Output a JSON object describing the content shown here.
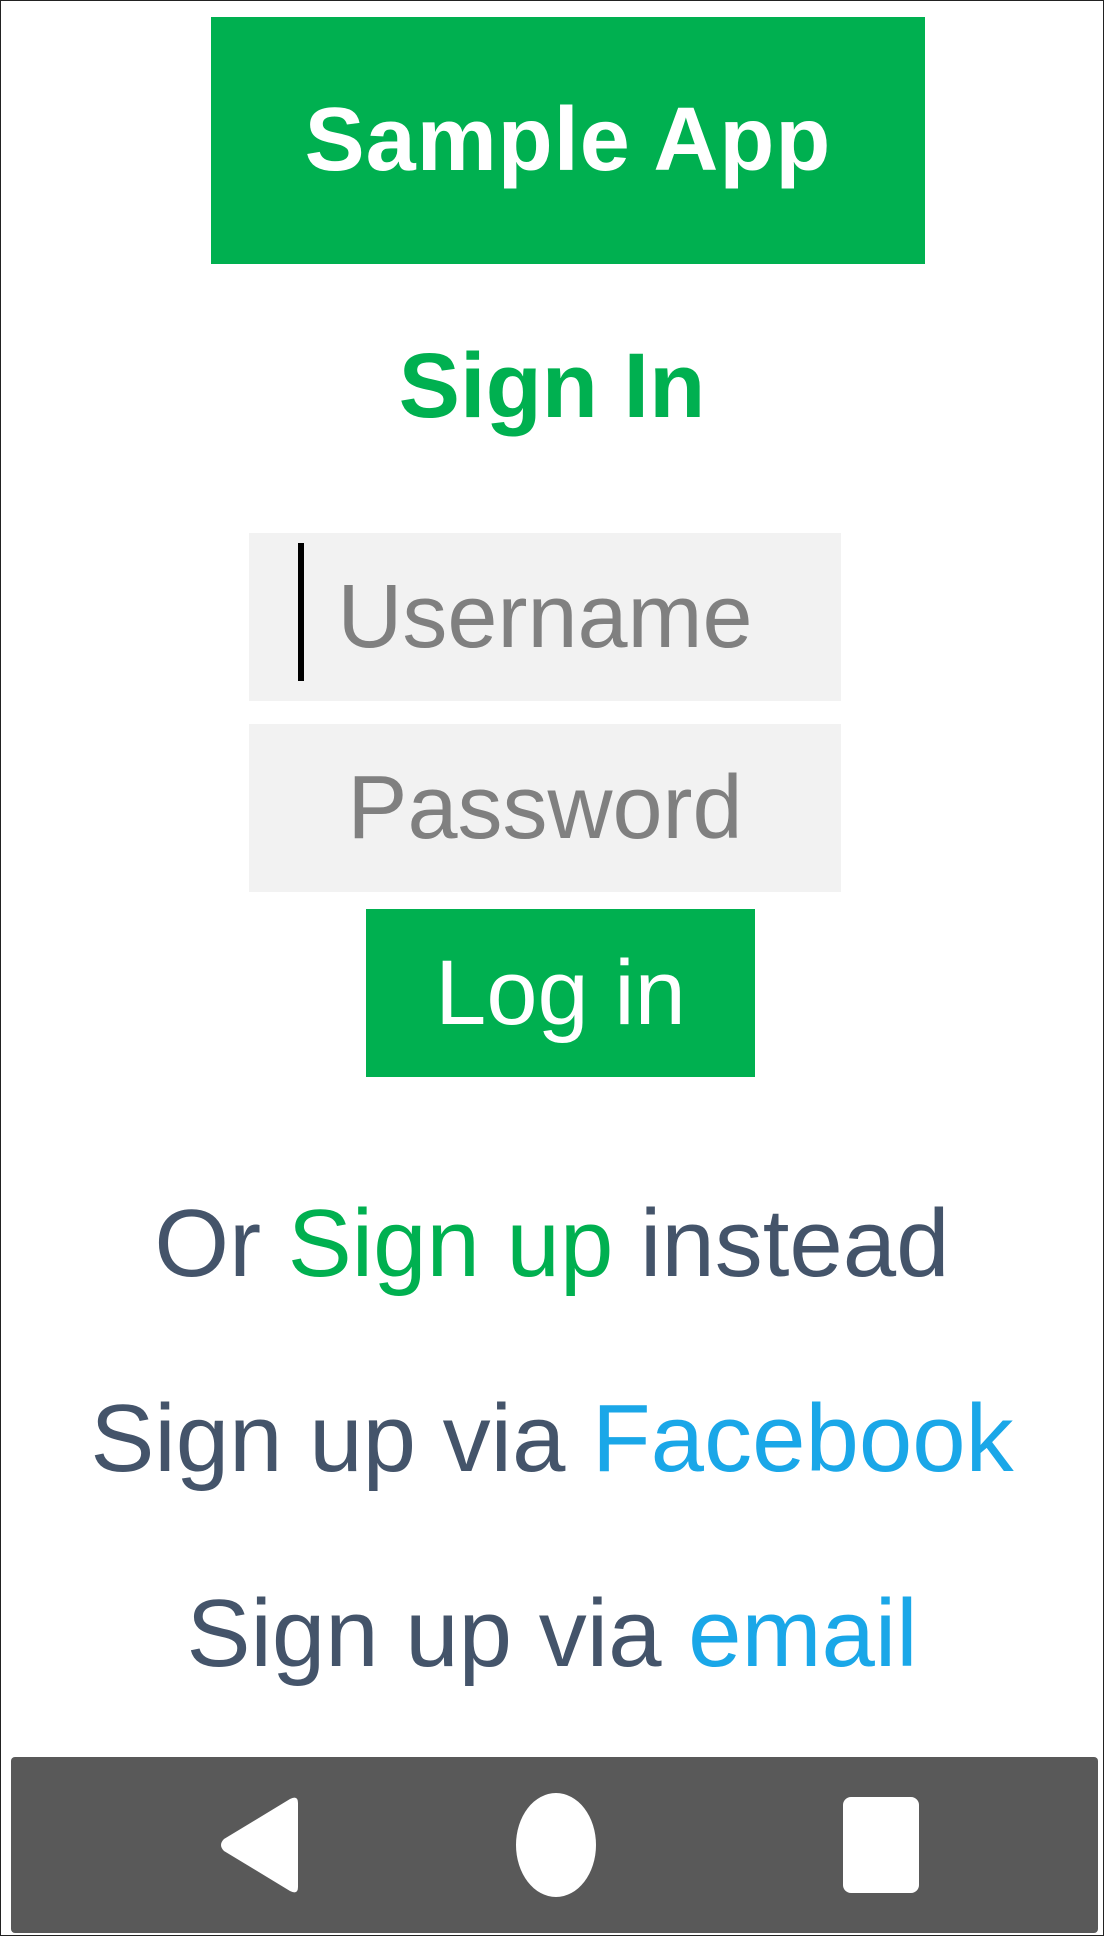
{
  "app": {
    "title": "Sample App"
  },
  "signin": {
    "heading": "Sign In",
    "username_placeholder": "Username",
    "password_placeholder": "Password",
    "login_label": "Log in"
  },
  "links": {
    "signup_prefix": "Or ",
    "signup_link": "Sign up",
    "signup_suffix": " instead",
    "facebook_prefix": "Sign up via ",
    "facebook_link": "Facebook",
    "email_prefix": "Sign up via ",
    "email_link": "email"
  },
  "navigation": {
    "back_icon": "back-triangle-icon",
    "home_icon": "home-circle-icon",
    "recent_icon": "recent-apps-square-icon"
  },
  "colors": {
    "brand_green": "#00b050",
    "link_blue": "#1aa7e8",
    "text_slate": "#44546a",
    "input_bg": "#f2f2f2",
    "nav_bar": "#595959"
  }
}
